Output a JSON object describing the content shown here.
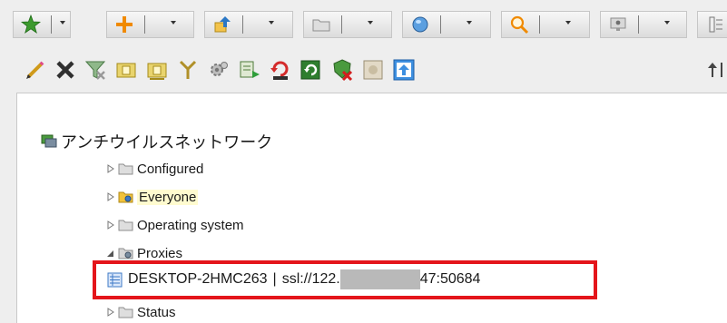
{
  "toolbar_top": {
    "buttons": [
      {
        "name": "favorites-dropdown-button",
        "icon": "star-icon"
      },
      {
        "name": "add-dropdown-button",
        "icon": "plus-icon"
      },
      {
        "name": "deploy-dropdown-button",
        "icon": "upload-icon"
      },
      {
        "name": "group-dropdown-button",
        "icon": "folder-icon"
      },
      {
        "name": "product-dropdown-button",
        "icon": "cube-icon"
      },
      {
        "name": "search-dropdown-button",
        "icon": "magnifier-icon"
      },
      {
        "name": "screen-dropdown-button",
        "icon": "monitor-icon"
      }
    ],
    "colors": {
      "star": "#3c9a2e",
      "plus": "#f08a00",
      "accent_blue": "#2b78c6"
    }
  },
  "toolbar_actions": {
    "icons": [
      "edit-pencil-icon",
      "delete-x-icon",
      "remove-filter-icon",
      "tag-icon",
      "tag-alt-icon",
      "merge-icon",
      "settings-gear-icon",
      "export-icon",
      "restore-icon",
      "refresh-icon",
      "shield-remove-icon",
      "disabled-icon",
      "move-up-icon",
      "collapse-arrows-icon"
    ]
  },
  "tree": {
    "root_label": "アンチウイルスネットワーク",
    "groups": [
      {
        "label": "Configured",
        "expanded": false,
        "icon": "folder-icon",
        "selected": false
      },
      {
        "label": "Everyone",
        "expanded": false,
        "icon": "folder-gear-icon",
        "selected": true
      },
      {
        "label": "Operating system",
        "expanded": false,
        "icon": "folder-icon",
        "selected": false
      },
      {
        "label": "Proxies",
        "expanded": true,
        "icon": "folder-gear-icon",
        "selected": false
      },
      {
        "label": "Status",
        "expanded": false,
        "icon": "folder-icon",
        "selected": false
      }
    ],
    "proxy_child": {
      "host": "DESKTOP-2HMC263",
      "separator": "|",
      "address_prefix": "ssl://122.",
      "address_suffix": "47:50684",
      "address_masked": true
    },
    "highlight_color": "#e4151b"
  }
}
